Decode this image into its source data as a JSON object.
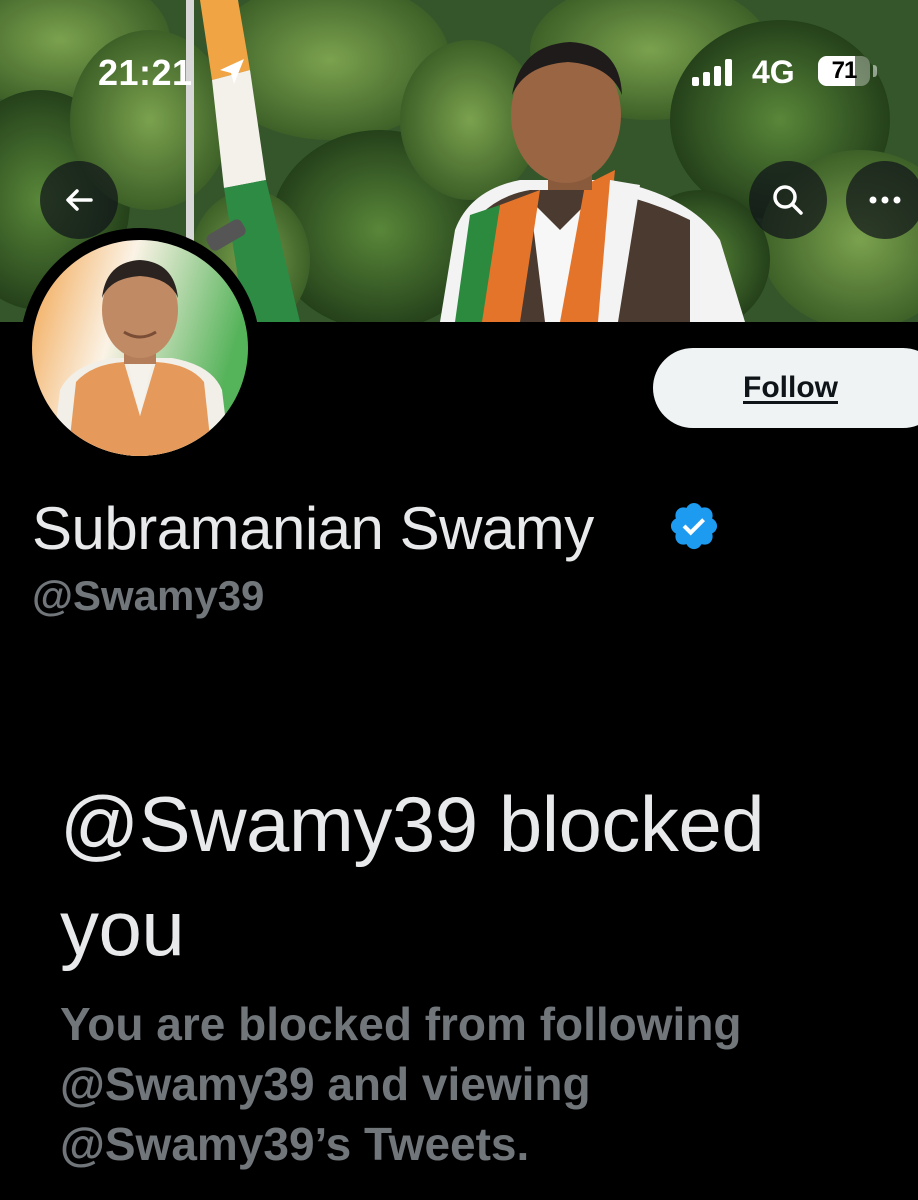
{
  "status_bar": {
    "time": "21:21",
    "network": "4G",
    "battery_level": "71",
    "battery_fraction": 0.71,
    "signal_bars": 4
  },
  "header": {
    "back_icon": "back-arrow-icon",
    "search_icon": "search-icon",
    "more_icon": "more-icon"
  },
  "profile": {
    "display_name": "Subramanian Swamy",
    "handle": "@Swamy39",
    "verified": true,
    "follow_label": "Follow"
  },
  "blocked": {
    "title": "@Swamy39 blocked you",
    "description": "You are blocked from following @Swamy39 and viewing @Swamy39’s Tweets."
  },
  "colors": {
    "background": "#000000",
    "primary_text": "#e7e9ea",
    "secondary_text": "#71767b",
    "verified_blue": "#1d9bf0",
    "follow_button_bg": "#eff3f4"
  }
}
